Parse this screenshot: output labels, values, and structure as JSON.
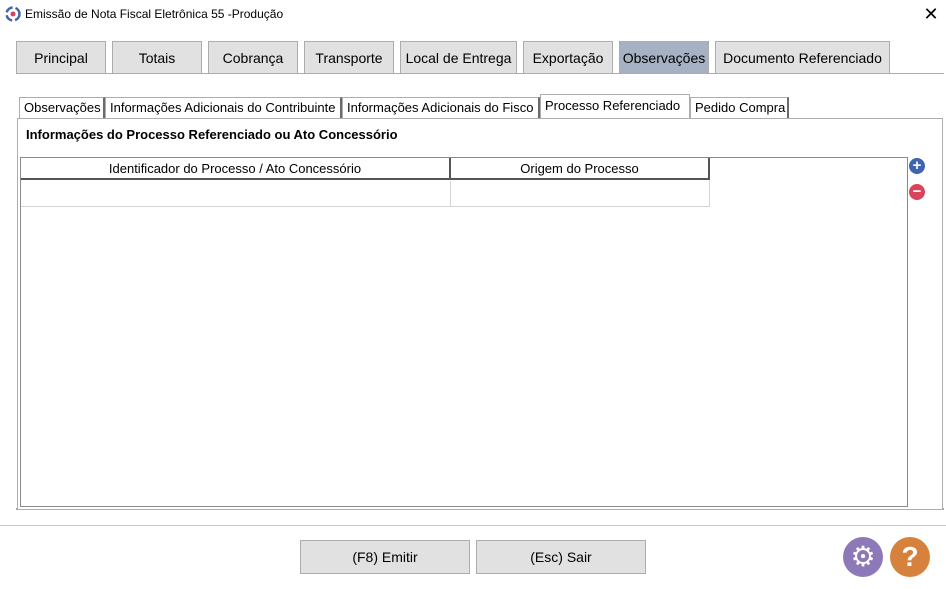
{
  "window": {
    "title": "Emissão de Nota Fiscal Eletrônica 55 -Produção",
    "close_glyph": "✕",
    "app_icon": "app-logo-icon"
  },
  "main_tabs": [
    {
      "label": "Principal"
    },
    {
      "label": "Totais"
    },
    {
      "label": "Cobrança"
    },
    {
      "label": "Transporte"
    },
    {
      "label": "Local de Entrega"
    },
    {
      "label": "Exportação"
    },
    {
      "label": "Observações",
      "active": true
    },
    {
      "label": "Documento Referenciado"
    }
  ],
  "sub_tabs": [
    {
      "label": "Observações"
    },
    {
      "label": "Informações Adicionais do Contribuinte"
    },
    {
      "label": "Informações Adicionais do Fisco"
    },
    {
      "label": "Processo Referenciado",
      "active": true
    },
    {
      "label": "Pedido Compra"
    }
  ],
  "panel": {
    "heading": "Informações do Processo Referenciado ou Ato Concessório",
    "grid": {
      "columns": [
        "Identificador do Processo / Ato Concessório",
        "Origem do Processo"
      ],
      "rows": [
        [
          "",
          ""
        ]
      ]
    },
    "add_icon": "plus-circle-icon",
    "remove_icon": "minus-circle-icon"
  },
  "footer": {
    "emit_label": "(F8) Emitir",
    "exit_label": "(Esc) Sair",
    "settings_icon": "gear-icon",
    "help_icon": "question-icon"
  },
  "colors": {
    "active_tab": "#a6b2c4",
    "add": "#3d64b0",
    "remove": "#d9435c",
    "gear": "#8e79b8",
    "help": "#d7823c"
  }
}
